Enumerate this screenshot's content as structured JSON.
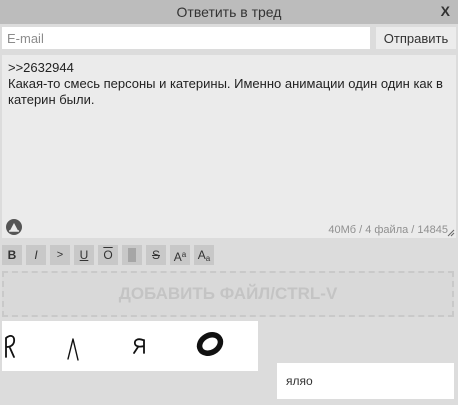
{
  "header": {
    "title": "Ответить в тред",
    "close_label": "X"
  },
  "form": {
    "email_placeholder": "E-mail",
    "send_label": "Отправить",
    "message": ">>2632944\nКакая-то смесь персоны и катерины. Именно анимации один один как в катерин были.",
    "counter": "40Мб / 4 файла / 14845"
  },
  "toolbar": {
    "buttons": [
      "B",
      "I",
      ">",
      "U",
      "O",
      "",
      "S",
      "A",
      "a",
      "A",
      "a"
    ]
  },
  "dropzone": {
    "label": "ДОБАВИТЬ ФАЙЛ/CTRL-V"
  },
  "captcha": {
    "answer": "яляо"
  },
  "icons": {
    "sage": "sage-icon",
    "resize": "resize-grip-icon",
    "close": "close-icon"
  }
}
